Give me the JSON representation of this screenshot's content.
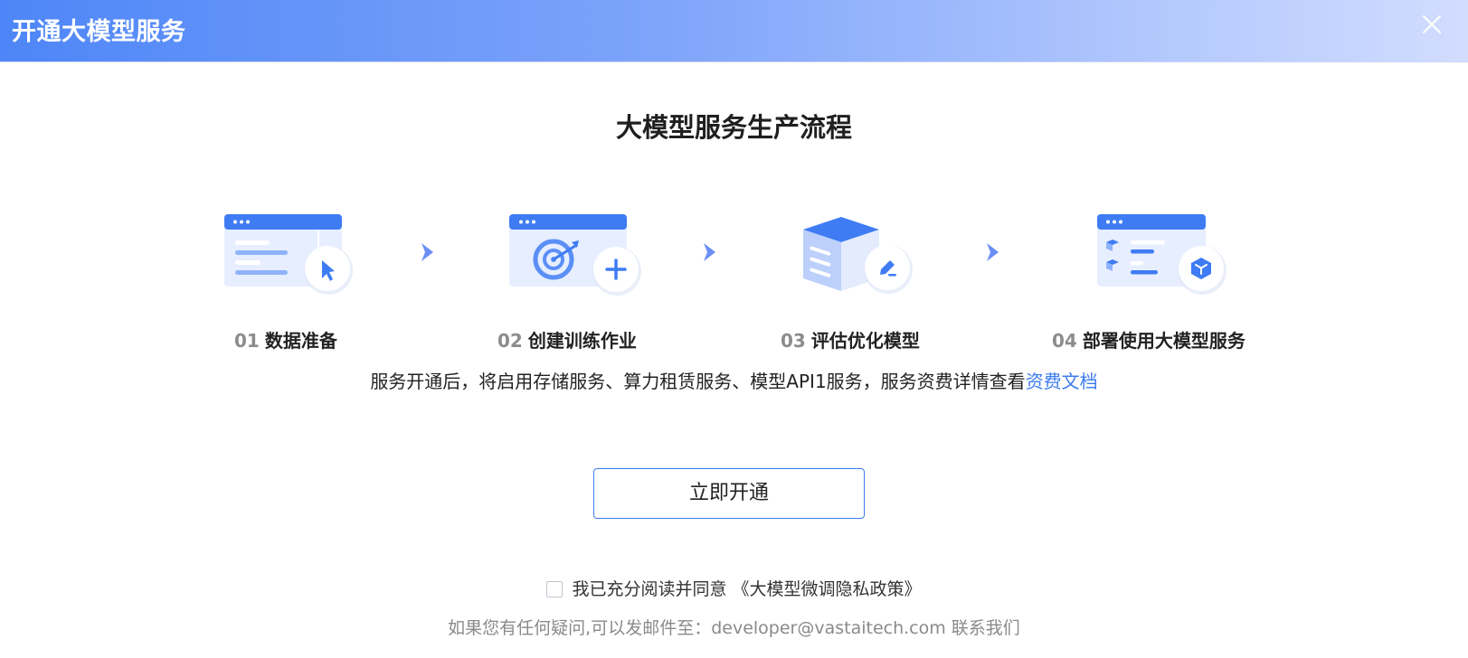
{
  "header": {
    "title": "开通大模型服务",
    "close_icon": "close-icon"
  },
  "main": {
    "title": "大模型服务生产流程",
    "steps": [
      {
        "num": "01",
        "label": "数据准备",
        "icon": "data-prep-icon"
      },
      {
        "num": "02",
        "label": "创建训练作业",
        "icon": "training-job-icon"
      },
      {
        "num": "03",
        "label": "评估优化模型",
        "icon": "model-eval-icon"
      },
      {
        "num": "04",
        "label": "部署使用大模型服务",
        "icon": "deploy-service-icon"
      }
    ],
    "notice_text": "服务开通后，将启用存储服务、算力租赁服务、模型API1服务，服务资费详情查看",
    "notice_link": "资费文档",
    "activate_button": "立即开通",
    "agree_text": "我已充分阅读并同意",
    "policy_link": "《大模型微调隐私政策》",
    "contact_text": "如果您有任何疑问,可以发邮件至：developer@vastaitech.com 联系我们"
  },
  "colors": {
    "header_start": "#4e86f7",
    "header_end": "#d2ddfe",
    "accent": "#3d7cf0",
    "arrow": "#6b8ef5"
  }
}
